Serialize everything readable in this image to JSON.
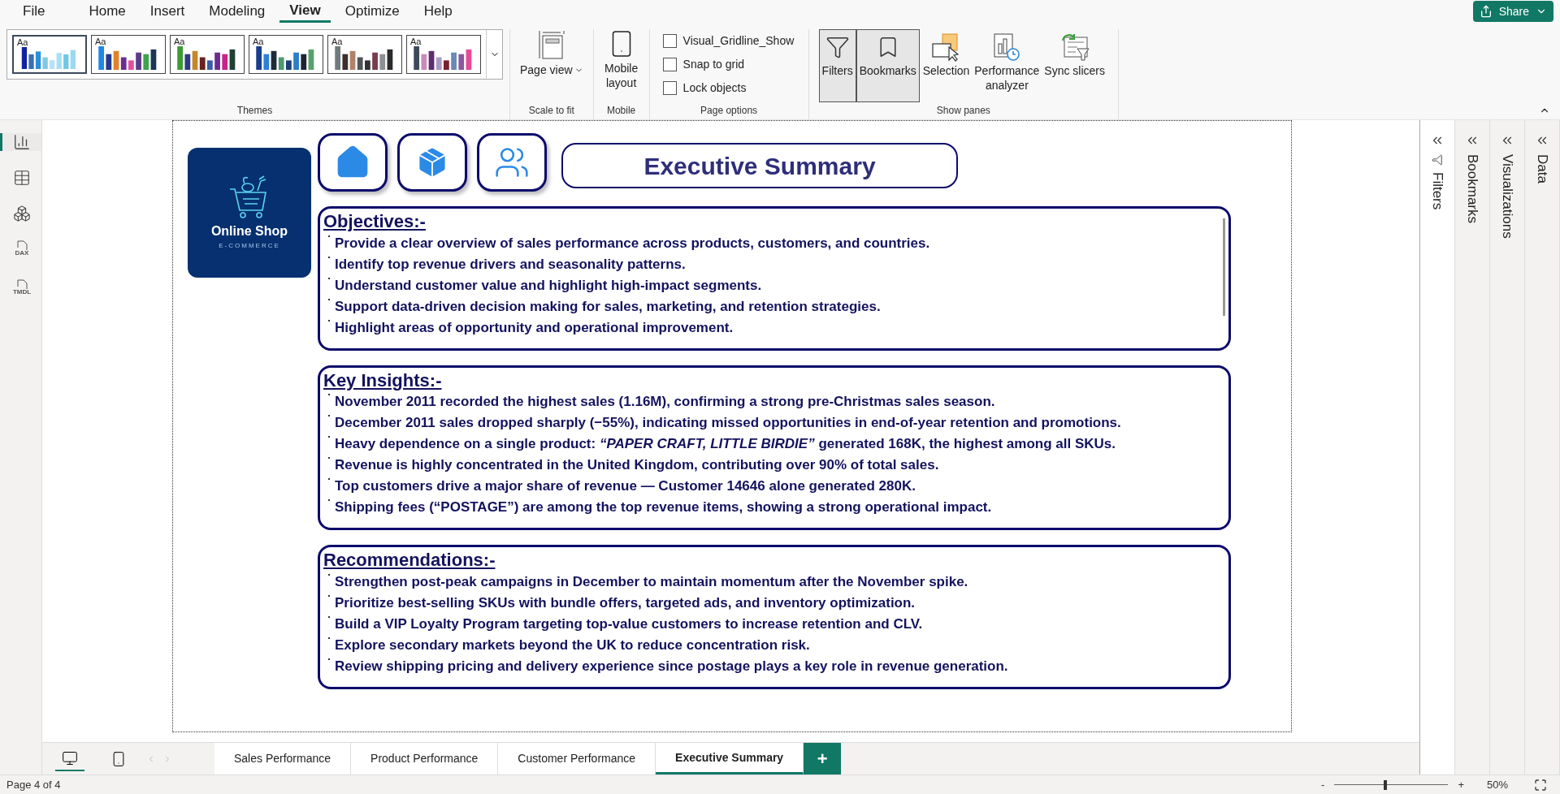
{
  "menu": {
    "tabs": [
      {
        "label": "File",
        "selected": false
      },
      {
        "label": "Home",
        "selected": false
      },
      {
        "label": "Insert",
        "selected": false
      },
      {
        "label": "Modeling",
        "selected": false
      },
      {
        "label": "View",
        "selected": true
      },
      {
        "label": "Optimize",
        "selected": false
      },
      {
        "label": "Help",
        "selected": false
      }
    ],
    "share": "Share"
  },
  "ribbon": {
    "themes": {
      "label": "Themes",
      "items": [
        {
          "sample": "Aa",
          "selected": true
        },
        {
          "sample": "Aa",
          "selected": false
        },
        {
          "sample": "Aa",
          "selected": false
        },
        {
          "sample": "Aa",
          "selected": false
        },
        {
          "sample": "Aa",
          "selected": false
        },
        {
          "sample": "Aa",
          "selected": false
        }
      ]
    },
    "scale": {
      "label": "Scale to fit",
      "button": "Page view"
    },
    "mobile": {
      "label": "Mobile",
      "button": "Mobile layout"
    },
    "page_options": {
      "label": "Page options",
      "options": [
        {
          "label": "Visual_Gridline_Show",
          "checked": false
        },
        {
          "label": "Snap to grid",
          "checked": false
        },
        {
          "label": "Lock objects",
          "checked": false
        }
      ]
    },
    "show_panes": {
      "label": "Show panes",
      "buttons": [
        {
          "kind": "filters",
          "label": "Filters",
          "selected": true
        },
        {
          "kind": "bookmarks",
          "label": "Bookmarks",
          "selected": true
        },
        {
          "kind": "selection",
          "label": "Selection",
          "selected": false
        },
        {
          "kind": "performance",
          "label": "Performance analyzer",
          "selected": false
        },
        {
          "kind": "sync",
          "label": "Sync slicers",
          "selected": false
        }
      ]
    }
  },
  "left_nav": [
    {
      "kind": "report",
      "selected": true
    },
    {
      "kind": "table",
      "selected": false
    },
    {
      "kind": "model",
      "selected": false
    },
    {
      "kind": "file",
      "label": "DAX",
      "selected": false
    },
    {
      "kind": "file",
      "label": "TMDL",
      "selected": false
    }
  ],
  "report": {
    "logo": {
      "name": "Online Shop",
      "tagline": "E-COMMERCE"
    },
    "nav_buttons": [
      {
        "kind": "home"
      },
      {
        "kind": "product"
      },
      {
        "kind": "customers"
      }
    ],
    "title": "Executive Summary",
    "sections": [
      {
        "heading": "Objectives:-",
        "items": [
          "Provide a clear overview of sales performance across products, customers, and countries.",
          "Identify top revenue drivers and seasonality patterns.",
          "Understand customer value and highlight high-impact segments.",
          "Support data-driven decision making for sales, marketing, and retention strategies.",
          "Highlight areas of opportunity and operational improvement."
        ]
      },
      {
        "heading": "Key Insights:-",
        "items": [
          "November 2011 recorded the highest sales (1.16M), confirming a strong pre-Christmas sales season.",
          "December 2011 sales dropped sharply (−55%), indicating missed opportunities in end-of-year retention and promotions.",
          "Heavy dependence on a single product: *“PAPER CRAFT, LITTLE BIRDIE”* generated 168K, the highest among all SKUs.",
          "Revenue is highly concentrated in the United Kingdom, contributing over 90% of total sales.",
          "Top customers drive a major share of revenue — Customer 14646 alone generated 280K.",
          "Shipping fees (“POSTAGE”) are among the top revenue items, showing a strong operational impact."
        ]
      },
      {
        "heading": "Recommendations:-",
        "items": [
          "Strengthen post-peak campaigns in December to maintain momentum after the November spike.",
          "Prioritize best-selling SKUs with bundle offers, targeted ads, and inventory optimization.",
          "Build a VIP Loyalty Program targeting top-value customers to increase retention and CLV.",
          "Explore secondary markets beyond the UK to reduce concentration risk.",
          "Review shipping pricing and delivery experience since postage plays a key role in revenue generation."
        ]
      }
    ]
  },
  "panes": [
    {
      "kind": "filters",
      "label": "Filters"
    },
    {
      "kind": "pane",
      "label": "Bookmarks"
    },
    {
      "kind": "pane",
      "label": "Visualizations"
    },
    {
      "kind": "pane",
      "label": "Data"
    }
  ],
  "view_modes": [
    {
      "kind": "desktop",
      "selected": true
    },
    {
      "kind": "mobile",
      "selected": false
    }
  ],
  "page_tabs": [
    {
      "label": "Sales Performance",
      "selected": false
    },
    {
      "label": "Product Performance",
      "selected": false
    },
    {
      "label": "Customer Performance",
      "selected": false
    },
    {
      "label": "Executive Summary",
      "selected": true
    }
  ],
  "add_page": "+",
  "status_bar": {
    "page": "Page 4 of 4",
    "zoom_out": "-",
    "zoom_in": "+",
    "zoom": {
      "level": 0.45
    },
    "zoom_reading": "50%"
  }
}
